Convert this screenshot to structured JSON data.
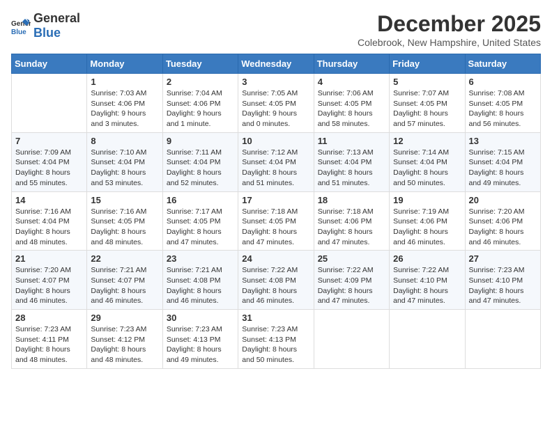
{
  "logo": {
    "general": "General",
    "blue": "Blue"
  },
  "title": "December 2025",
  "location": "Colebrook, New Hampshire, United States",
  "weekdays": [
    "Sunday",
    "Monday",
    "Tuesday",
    "Wednesday",
    "Thursday",
    "Friday",
    "Saturday"
  ],
  "weeks": [
    [
      {
        "day": "",
        "sunrise": "",
        "sunset": "",
        "daylight": ""
      },
      {
        "day": "1",
        "sunrise": "Sunrise: 7:03 AM",
        "sunset": "Sunset: 4:06 PM",
        "daylight": "Daylight: 9 hours and 3 minutes."
      },
      {
        "day": "2",
        "sunrise": "Sunrise: 7:04 AM",
        "sunset": "Sunset: 4:06 PM",
        "daylight": "Daylight: 9 hours and 1 minute."
      },
      {
        "day": "3",
        "sunrise": "Sunrise: 7:05 AM",
        "sunset": "Sunset: 4:05 PM",
        "daylight": "Daylight: 9 hours and 0 minutes."
      },
      {
        "day": "4",
        "sunrise": "Sunrise: 7:06 AM",
        "sunset": "Sunset: 4:05 PM",
        "daylight": "Daylight: 8 hours and 58 minutes."
      },
      {
        "day": "5",
        "sunrise": "Sunrise: 7:07 AM",
        "sunset": "Sunset: 4:05 PM",
        "daylight": "Daylight: 8 hours and 57 minutes."
      },
      {
        "day": "6",
        "sunrise": "Sunrise: 7:08 AM",
        "sunset": "Sunset: 4:05 PM",
        "daylight": "Daylight: 8 hours and 56 minutes."
      }
    ],
    [
      {
        "day": "7",
        "sunrise": "Sunrise: 7:09 AM",
        "sunset": "Sunset: 4:04 PM",
        "daylight": "Daylight: 8 hours and 55 minutes."
      },
      {
        "day": "8",
        "sunrise": "Sunrise: 7:10 AM",
        "sunset": "Sunset: 4:04 PM",
        "daylight": "Daylight: 8 hours and 53 minutes."
      },
      {
        "day": "9",
        "sunrise": "Sunrise: 7:11 AM",
        "sunset": "Sunset: 4:04 PM",
        "daylight": "Daylight: 8 hours and 52 minutes."
      },
      {
        "day": "10",
        "sunrise": "Sunrise: 7:12 AM",
        "sunset": "Sunset: 4:04 PM",
        "daylight": "Daylight: 8 hours and 51 minutes."
      },
      {
        "day": "11",
        "sunrise": "Sunrise: 7:13 AM",
        "sunset": "Sunset: 4:04 PM",
        "daylight": "Daylight: 8 hours and 51 minutes."
      },
      {
        "day": "12",
        "sunrise": "Sunrise: 7:14 AM",
        "sunset": "Sunset: 4:04 PM",
        "daylight": "Daylight: 8 hours and 50 minutes."
      },
      {
        "day": "13",
        "sunrise": "Sunrise: 7:15 AM",
        "sunset": "Sunset: 4:04 PM",
        "daylight": "Daylight: 8 hours and 49 minutes."
      }
    ],
    [
      {
        "day": "14",
        "sunrise": "Sunrise: 7:16 AM",
        "sunset": "Sunset: 4:04 PM",
        "daylight": "Daylight: 8 hours and 48 minutes."
      },
      {
        "day": "15",
        "sunrise": "Sunrise: 7:16 AM",
        "sunset": "Sunset: 4:05 PM",
        "daylight": "Daylight: 8 hours and 48 minutes."
      },
      {
        "day": "16",
        "sunrise": "Sunrise: 7:17 AM",
        "sunset": "Sunset: 4:05 PM",
        "daylight": "Daylight: 8 hours and 47 minutes."
      },
      {
        "day": "17",
        "sunrise": "Sunrise: 7:18 AM",
        "sunset": "Sunset: 4:05 PM",
        "daylight": "Daylight: 8 hours and 47 minutes."
      },
      {
        "day": "18",
        "sunrise": "Sunrise: 7:18 AM",
        "sunset": "Sunset: 4:06 PM",
        "daylight": "Daylight: 8 hours and 47 minutes."
      },
      {
        "day": "19",
        "sunrise": "Sunrise: 7:19 AM",
        "sunset": "Sunset: 4:06 PM",
        "daylight": "Daylight: 8 hours and 46 minutes."
      },
      {
        "day": "20",
        "sunrise": "Sunrise: 7:20 AM",
        "sunset": "Sunset: 4:06 PM",
        "daylight": "Daylight: 8 hours and 46 minutes."
      }
    ],
    [
      {
        "day": "21",
        "sunrise": "Sunrise: 7:20 AM",
        "sunset": "Sunset: 4:07 PM",
        "daylight": "Daylight: 8 hours and 46 minutes."
      },
      {
        "day": "22",
        "sunrise": "Sunrise: 7:21 AM",
        "sunset": "Sunset: 4:07 PM",
        "daylight": "Daylight: 8 hours and 46 minutes."
      },
      {
        "day": "23",
        "sunrise": "Sunrise: 7:21 AM",
        "sunset": "Sunset: 4:08 PM",
        "daylight": "Daylight: 8 hours and 46 minutes."
      },
      {
        "day": "24",
        "sunrise": "Sunrise: 7:22 AM",
        "sunset": "Sunset: 4:08 PM",
        "daylight": "Daylight: 8 hours and 46 minutes."
      },
      {
        "day": "25",
        "sunrise": "Sunrise: 7:22 AM",
        "sunset": "Sunset: 4:09 PM",
        "daylight": "Daylight: 8 hours and 47 minutes."
      },
      {
        "day": "26",
        "sunrise": "Sunrise: 7:22 AM",
        "sunset": "Sunset: 4:10 PM",
        "daylight": "Daylight: 8 hours and 47 minutes."
      },
      {
        "day": "27",
        "sunrise": "Sunrise: 7:23 AM",
        "sunset": "Sunset: 4:10 PM",
        "daylight": "Daylight: 8 hours and 47 minutes."
      }
    ],
    [
      {
        "day": "28",
        "sunrise": "Sunrise: 7:23 AM",
        "sunset": "Sunset: 4:11 PM",
        "daylight": "Daylight: 8 hours and 48 minutes."
      },
      {
        "day": "29",
        "sunrise": "Sunrise: 7:23 AM",
        "sunset": "Sunset: 4:12 PM",
        "daylight": "Daylight: 8 hours and 48 minutes."
      },
      {
        "day": "30",
        "sunrise": "Sunrise: 7:23 AM",
        "sunset": "Sunset: 4:13 PM",
        "daylight": "Daylight: 8 hours and 49 minutes."
      },
      {
        "day": "31",
        "sunrise": "Sunrise: 7:23 AM",
        "sunset": "Sunset: 4:13 PM",
        "daylight": "Daylight: 8 hours and 50 minutes."
      },
      {
        "day": "",
        "sunrise": "",
        "sunset": "",
        "daylight": ""
      },
      {
        "day": "",
        "sunrise": "",
        "sunset": "",
        "daylight": ""
      },
      {
        "day": "",
        "sunrise": "",
        "sunset": "",
        "daylight": ""
      }
    ]
  ]
}
